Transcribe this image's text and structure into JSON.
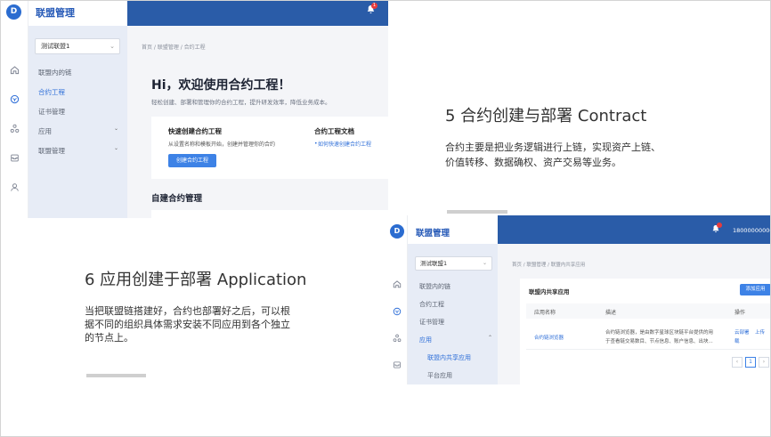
{
  "slide5": {
    "heading": "5 合约创建与部署 Contract",
    "body_line1": "合约主要是把业务逻辑进行上链，实现资产上链、",
    "body_line2": "价值转移、数据确权、资产交易等业务。"
  },
  "slide6": {
    "heading": "6 应用创建于部署 Application",
    "body_line1": "当把联盟链搭建好，合约也部署好之后，可以根",
    "body_line2": "据不同的组织具体需求安装不同应用到各个独立",
    "body_line3": "的节点上。"
  },
  "shot1": {
    "brand": "联盟管理",
    "logo_glyph": "D",
    "badge": "1",
    "alliance_select": "测试联盟1",
    "nav": {
      "alliance_chain": "联盟内的链",
      "contract_project": "合约工程",
      "cert_mgmt": "证书管理",
      "apps": "应用",
      "alliance_mgmt": "联盟管理"
    },
    "breadcrumb": "首页  /  联盟管理  /  合约工程",
    "hello": "Hi，欢迎使用合约工程！",
    "subtitle": "轻松创建、部署和管理你的合约工程，提升研发效率，降低业务成本。",
    "quick_title": "快速创建合约工程",
    "quick_desc": "从设置名称和模板开始，创建并管理你的合约",
    "create_button": "创建合约工程",
    "doc_title": "合约工程文档",
    "doc_link": "如何快速创建合约工程",
    "self_built_title": "自建合约管理"
  },
  "shot2": {
    "brand": "联盟管理",
    "logo_glyph": "D",
    "phone": "18000000000",
    "alliance_select": "测试联盟1",
    "nav": {
      "alliance_chain": "联盟内的链",
      "contract_project": "合约工程",
      "cert_mgmt": "证书管理",
      "apps": "应用",
      "shared_apps": "联盟内共享应用",
      "platform_apps": "平台应用"
    },
    "breadcrumb": "首页  /  联盟管理  /  联盟内共享应用",
    "panel_title": "联盟内共享应用",
    "add_button": "添加应用",
    "table": {
      "col_name": "应用名称",
      "col_desc": "描述",
      "col_ops": "操作",
      "row1_name": "合约链浏览器",
      "row1_desc_line1": "合约链浏览器，是由数字星球区块链平台提供的用",
      "row1_desc_line2": "于查看链交易数目、节点信息、账户信息、出块...",
      "row1_op1": "云部署",
      "row1_op2": "上传",
      "row1_op3": "载"
    },
    "pagination": {
      "prev": "‹",
      "current": "1",
      "next": "›"
    }
  },
  "colors": {
    "topbar": "#2a5ca8",
    "brand_text": "#2559b7",
    "accent": "#3d82e6",
    "sidebar": "#e7ecf6",
    "badge": "#e83b3b"
  },
  "icons": {
    "rail": [
      "home-icon",
      "contract-icon",
      "network-icon",
      "inbox-icon",
      "user-icon"
    ],
    "bell": "bell-icon"
  }
}
